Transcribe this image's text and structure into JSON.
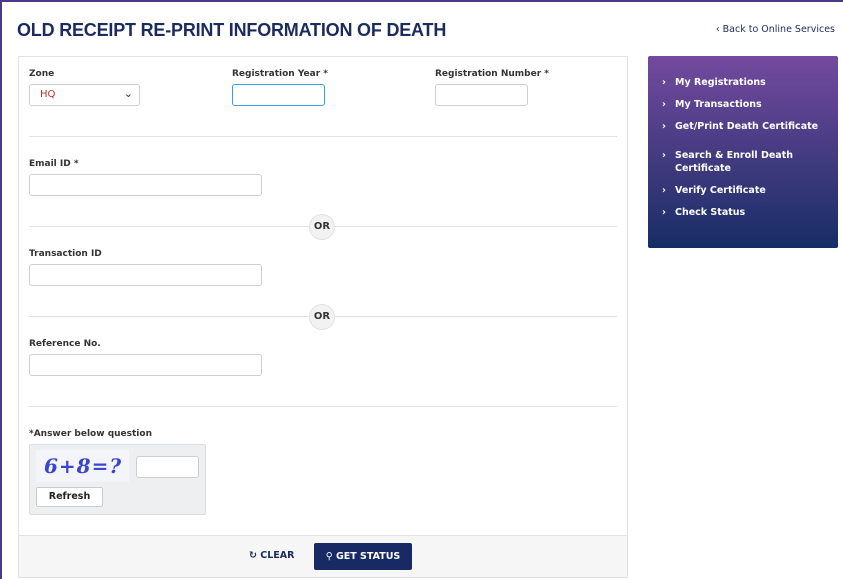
{
  "page": {
    "title": "OLD RECEIPT RE-PRINT INFORMATION OF DEATH",
    "back_link": "‹ Back to Online Services"
  },
  "form": {
    "zone_label": "Zone",
    "zone_value": "HQ",
    "reg_year_label": "Registration Year *",
    "reg_number_label": "Registration Number *",
    "email_label": "Email ID *",
    "or1": "OR",
    "transaction_label": "Transaction ID",
    "or2": "OR",
    "reference_label": "Reference No.",
    "captcha_label": "*Answer below question",
    "captcha_text": "6+8=?",
    "refresh_label": "Refresh",
    "clear_label": "CLEAR",
    "get_status_label": "GET STATUS"
  },
  "sidebar": {
    "items": [
      {
        "label": "My Registrations"
      },
      {
        "label": "My Transactions"
      },
      {
        "label": "Get/Print Death Certificate"
      },
      {
        "label": "Search & Enroll Death Certificate"
      },
      {
        "label": "Verify Certificate"
      },
      {
        "label": "Check Status"
      }
    ]
  }
}
